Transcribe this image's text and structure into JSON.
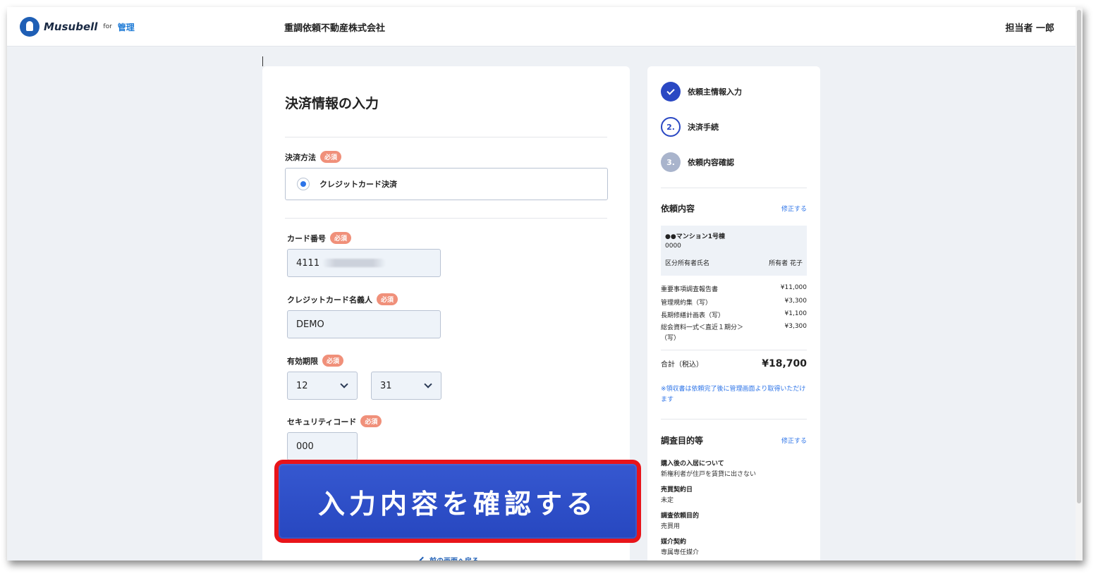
{
  "header": {
    "logo_text": "Musubell",
    "logo_for": "for",
    "logo_kanri": "管理",
    "company": "重調依頼不動産株式会社",
    "user": "担当者 一郎"
  },
  "form": {
    "title": "決済情報の入力",
    "required_badge": "必須",
    "payment_method": {
      "label": "決済方法",
      "option": "クレジットカード決済"
    },
    "card_number": {
      "label": "カード番号",
      "value": "4111"
    },
    "card_holder": {
      "label": "クレジットカード名義人",
      "value": "DEMO"
    },
    "expiry": {
      "label": "有効期限",
      "month": "12",
      "year": "31"
    },
    "security_code": {
      "label": "セキュリティコード",
      "value": "000"
    },
    "confirm_button": "入力内容を確認する",
    "back_link": "前の画面へ戻る"
  },
  "steps": [
    {
      "number": "",
      "label": "依頼主情報入力",
      "state": "done"
    },
    {
      "number": "2.",
      "label": "決済手続",
      "state": "current"
    },
    {
      "number": "3.",
      "label": "依頼内容確認",
      "state": "todo"
    }
  ],
  "request": {
    "title": "依頼内容",
    "edit_label": "修正する",
    "property_name": "●●マンション1号棟",
    "property_code": "0000",
    "owner_label": "区分所有者氏名",
    "owner_value": "所有者 花子",
    "items": [
      {
        "name": "重要事項調査報告書",
        "price": "¥11,000"
      },
      {
        "name": "管理規約集（写）",
        "price": "¥3,300"
      },
      {
        "name": "長期修繕計画表（写）",
        "price": "¥1,100"
      },
      {
        "name": "総会資料一式＜直近１期分＞",
        "name2": "（写）",
        "price": "¥3,300"
      }
    ],
    "total_label": "合計（税込）",
    "total_value": "¥18,700",
    "note": "※領収書は依頼完了後に管理画面より取得いただけます"
  },
  "purpose": {
    "title": "調査目的等",
    "edit_label": "修正する",
    "items": [
      {
        "label": "購入後の入居について",
        "value": "新権利者が住戸を賃貸に出さない"
      },
      {
        "label": "売買契約日",
        "value": "未定"
      },
      {
        "label": "調査依頼目的",
        "value": "売買用"
      },
      {
        "label": "媒介契約",
        "value": "専属専任媒介"
      }
    ]
  },
  "colors": {
    "primary": "#2a48c3",
    "link": "#2d74e8",
    "required": "#f0907a",
    "highlight": "#e8141a"
  }
}
